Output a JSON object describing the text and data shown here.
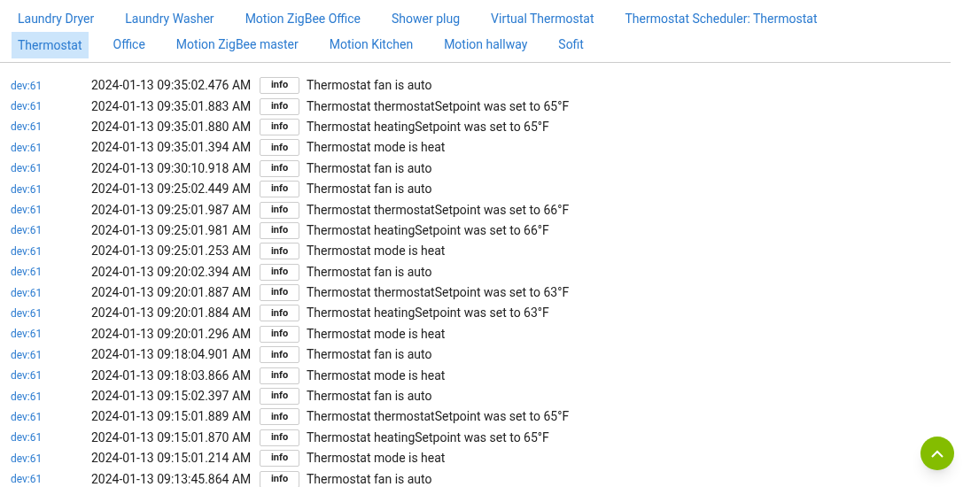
{
  "tabs": [
    {
      "label": "Laundry Dryer",
      "selected": false
    },
    {
      "label": "Laundry Washer",
      "selected": false
    },
    {
      "label": "Motion ZigBee Office",
      "selected": false
    },
    {
      "label": "Shower plug",
      "selected": false
    },
    {
      "label": "Virtual Thermostat",
      "selected": false
    },
    {
      "label": "Thermostat Scheduler: Thermostat",
      "selected": false
    },
    {
      "label": "Thermostat",
      "selected": true
    },
    {
      "label": "Office",
      "selected": false
    },
    {
      "label": "Motion ZigBee master",
      "selected": false
    },
    {
      "label": "Motion Kitchen",
      "selected": false
    },
    {
      "label": "Motion hallway",
      "selected": false
    },
    {
      "label": "Sofit",
      "selected": false
    }
  ],
  "log": [
    {
      "device": "dev:61",
      "time": "2024-01-13 09:35:02.476 AM",
      "level": "info",
      "message": "Thermostat fan is auto"
    },
    {
      "device": "dev:61",
      "time": "2024-01-13 09:35:01.883 AM",
      "level": "info",
      "message": "Thermostat thermostatSetpoint was set to 65°F"
    },
    {
      "device": "dev:61",
      "time": "2024-01-13 09:35:01.880 AM",
      "level": "info",
      "message": "Thermostat heatingSetpoint was set to 65°F"
    },
    {
      "device": "dev:61",
      "time": "2024-01-13 09:35:01.394 AM",
      "level": "info",
      "message": "Thermostat mode is heat"
    },
    {
      "device": "dev:61",
      "time": "2024-01-13 09:30:10.918 AM",
      "level": "info",
      "message": "Thermostat fan is auto"
    },
    {
      "device": "dev:61",
      "time": "2024-01-13 09:25:02.449 AM",
      "level": "info",
      "message": "Thermostat fan is auto"
    },
    {
      "device": "dev:61",
      "time": "2024-01-13 09:25:01.987 AM",
      "level": "info",
      "message": "Thermostat thermostatSetpoint was set to 66°F"
    },
    {
      "device": "dev:61",
      "time": "2024-01-13 09:25:01.981 AM",
      "level": "info",
      "message": "Thermostat heatingSetpoint was set to 66°F"
    },
    {
      "device": "dev:61",
      "time": "2024-01-13 09:25:01.253 AM",
      "level": "info",
      "message": "Thermostat mode is heat"
    },
    {
      "device": "dev:61",
      "time": "2024-01-13 09:20:02.394 AM",
      "level": "info",
      "message": "Thermostat fan is auto"
    },
    {
      "device": "dev:61",
      "time": "2024-01-13 09:20:01.887 AM",
      "level": "info",
      "message": "Thermostat thermostatSetpoint was set to 63°F"
    },
    {
      "device": "dev:61",
      "time": "2024-01-13 09:20:01.884 AM",
      "level": "info",
      "message": "Thermostat heatingSetpoint was set to 63°F"
    },
    {
      "device": "dev:61",
      "time": "2024-01-13 09:20:01.296 AM",
      "level": "info",
      "message": "Thermostat mode is heat"
    },
    {
      "device": "dev:61",
      "time": "2024-01-13 09:18:04.901 AM",
      "level": "info",
      "message": "Thermostat fan is auto"
    },
    {
      "device": "dev:61",
      "time": "2024-01-13 09:18:03.866 AM",
      "level": "info",
      "message": "Thermostat mode is heat"
    },
    {
      "device": "dev:61",
      "time": "2024-01-13 09:15:02.397 AM",
      "level": "info",
      "message": "Thermostat fan is auto"
    },
    {
      "device": "dev:61",
      "time": "2024-01-13 09:15:01.889 AM",
      "level": "info",
      "message": "Thermostat thermostatSetpoint was set to 65°F"
    },
    {
      "device": "dev:61",
      "time": "2024-01-13 09:15:01.870 AM",
      "level": "info",
      "message": "Thermostat heatingSetpoint was set to 65°F"
    },
    {
      "device": "dev:61",
      "time": "2024-01-13 09:15:01.214 AM",
      "level": "info",
      "message": "Thermostat mode is heat"
    },
    {
      "device": "dev:61",
      "time": "2024-01-13 09:13:45.864 AM",
      "level": "info",
      "message": "Thermostat fan is auto"
    }
  ]
}
